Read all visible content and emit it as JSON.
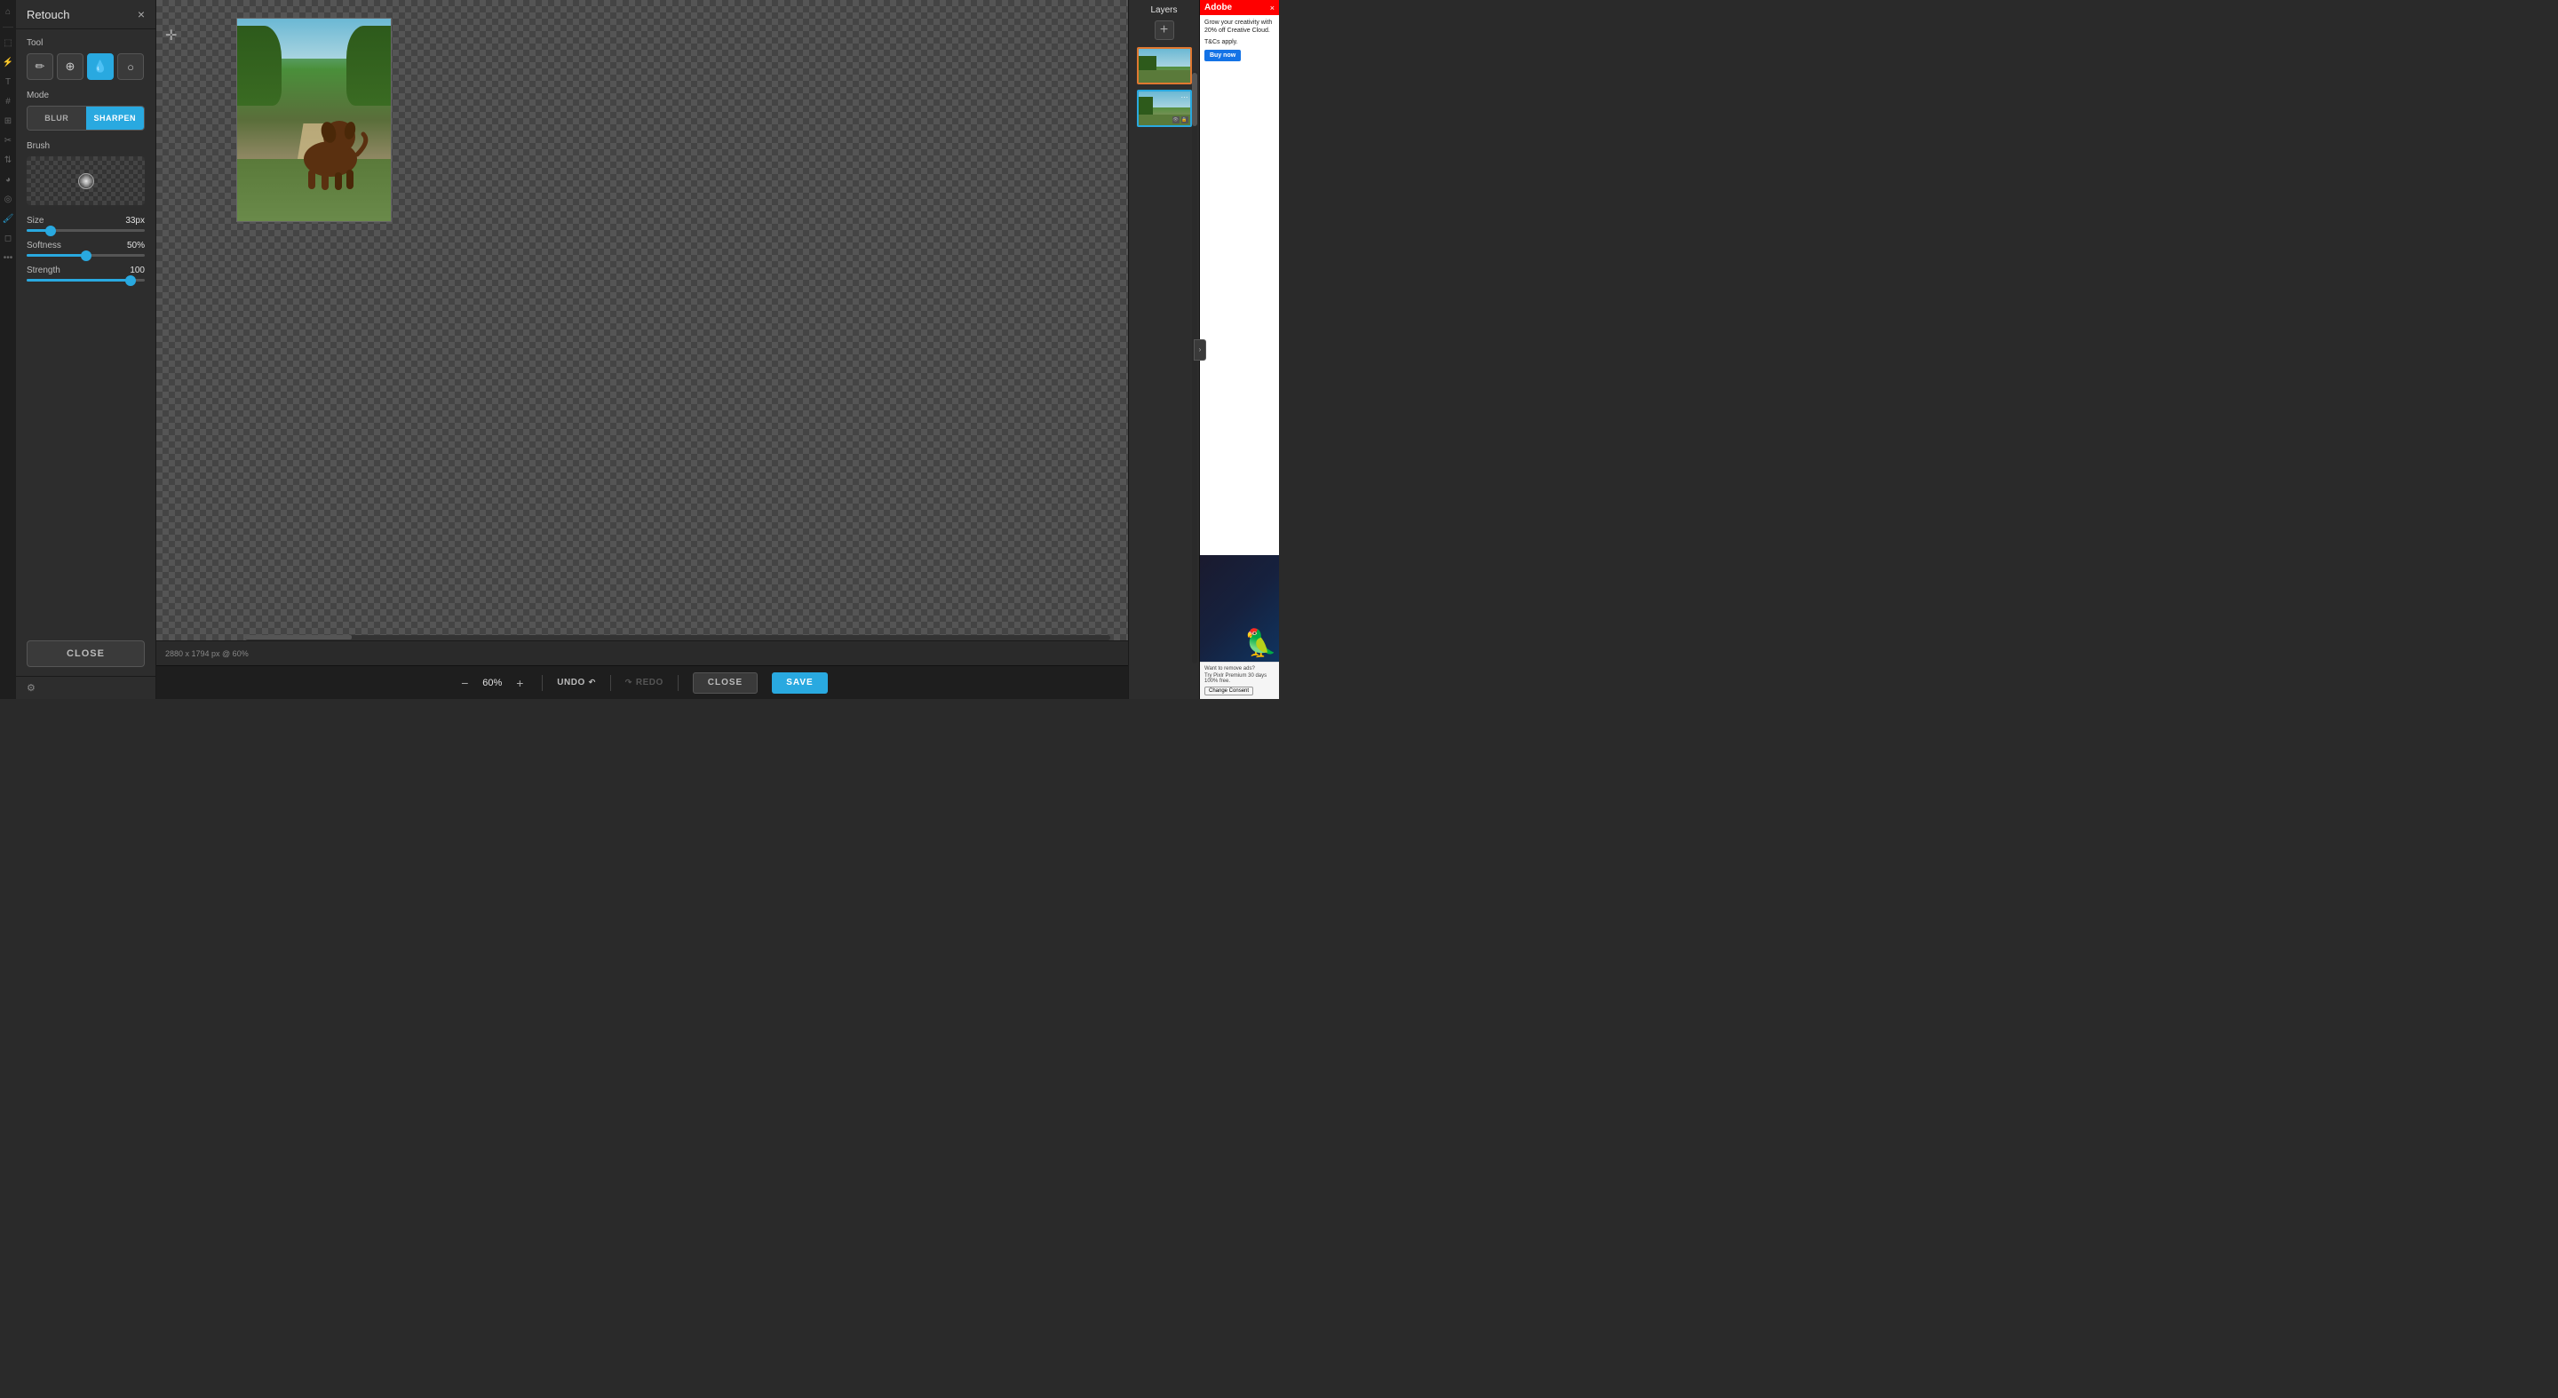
{
  "app": {
    "title": "Retouch"
  },
  "retouch_panel": {
    "title": "Retouch",
    "close_label": "×",
    "tool_section": "Tool",
    "mode_section": "Mode",
    "brush_section": "Brush",
    "blur_label": "BLUR",
    "sharpen_label": "SHARPEN",
    "size_label": "Size",
    "size_value": "33px",
    "size_pct": 20,
    "softness_label": "Softness",
    "softness_value": "50%",
    "softness_pct": 50,
    "strength_label": "Strength",
    "strength_value": "100",
    "strength_pct": 88,
    "close_btn": "CLOSE"
  },
  "canvas": {
    "status_text": "2880 x 1794 px @ 60%",
    "zoom_value": "60%"
  },
  "toolbar": {
    "undo_label": "UNDO",
    "redo_label": "REDO",
    "close_label": "CLOSE",
    "save_label": "SAVE"
  },
  "layers": {
    "title": "Layers",
    "add_label": "+"
  },
  "ad": {
    "logo": "Adobe",
    "headline": "Grow your creativity with 20% off Creative Cloud.",
    "terms": "T&Cs apply.",
    "cta": "Buy now",
    "remove_ads": "Want to remove ads?",
    "premium_text": "Try Pixlr Premium\n30 days 100% free.",
    "consent_label": "Change Consent"
  }
}
